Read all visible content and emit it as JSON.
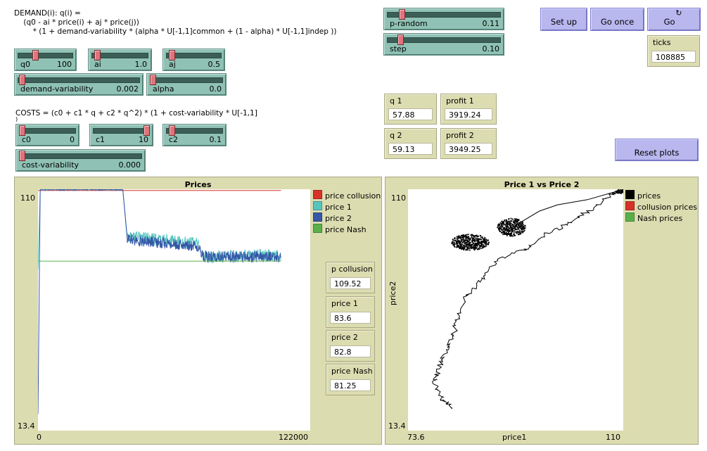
{
  "notes": {
    "demand_line1": "DEMAND(i): q(i) =",
    "demand_line2": "    (q0 - ai * price(i) + aj * price(j))",
    "demand_line3": "        * (1 + demand-variability * (alpha * U[-1,1]common + (1 - alpha) * U[-1,1]indep ))",
    "costs_line1": "COSTS = (c0 + c1 * q + c2 * q^2) * (1 + cost-variability * U[-1,1]",
    "costs_line2": ")"
  },
  "sliders": {
    "q0": {
      "label": "q0",
      "value": "100",
      "fraction": 0.3
    },
    "ai": {
      "label": "ai",
      "value": "1.0",
      "fraction": 0.05
    },
    "aj": {
      "label": "aj",
      "value": "0.5",
      "fraction": 0.05
    },
    "demand_variability": {
      "label": "demand-variability",
      "value": "0.002",
      "fraction": 0.01
    },
    "alpha": {
      "label": "alpha",
      "value": "0.0",
      "fraction": 0.0
    },
    "c0": {
      "label": "c0",
      "value": "0",
      "fraction": 0.0
    },
    "c1": {
      "label": "c1",
      "value": "10",
      "fraction": 1.0
    },
    "c2": {
      "label": "c2",
      "value": "0.1",
      "fraction": 0.05
    },
    "cost_variability": {
      "label": "cost-variability",
      "value": "0.000",
      "fraction": 0.0
    },
    "p_random": {
      "label": "p-random",
      "value": "0.11",
      "fraction": 0.11
    },
    "step": {
      "label": "step",
      "value": "0.10",
      "fraction": 0.1
    }
  },
  "buttons": {
    "setup": "Set up",
    "go_once": "Go once",
    "go": "Go",
    "reset_plots": "Reset plots"
  },
  "monitors": {
    "ticks": {
      "label": "ticks",
      "value": "108885"
    },
    "q1": {
      "label": "q 1",
      "value": "57.88"
    },
    "profit1": {
      "label": "profit 1",
      "value": "3919.24"
    },
    "q2": {
      "label": "q 2",
      "value": "59.13"
    },
    "profit2": {
      "label": "profit 2",
      "value": "3949.25"
    },
    "p_collusion": {
      "label": "p collusion",
      "value": "109.52"
    },
    "price1": {
      "label": "price 1",
      "value": "83.6"
    },
    "price2": {
      "label": "price 2",
      "value": "82.8"
    },
    "price_nash": {
      "label": "price Nash",
      "value": "81.25"
    }
  },
  "prices_plot": {
    "title": "Prices",
    "y_max_label": "110",
    "y_min_label": "13.4",
    "x_min_label": "0",
    "x_max_label": "122000",
    "legend": [
      {
        "name": "price collusion",
        "color": "#d73229"
      },
      {
        "name": "price 1",
        "color": "#57c4c0"
      },
      {
        "name": "price 2",
        "color": "#3656a8"
      },
      {
        "name": "price Nash",
        "color": "#59b04b"
      }
    ]
  },
  "scatter_plot": {
    "title": "Price 1 vs Price 2",
    "y_max_label": "110",
    "y_min_label": "13.4",
    "x_min_label": "73.6",
    "x_max_label": "110",
    "xlabel": "price1",
    "ylabel": "price2",
    "legend": [
      {
        "name": "prices",
        "color": "#000000"
      },
      {
        "name": "collusion prices",
        "color": "#d73229"
      },
      {
        "name": "Nash prices",
        "color": "#59b04b"
      }
    ]
  },
  "chart_data": [
    {
      "type": "line",
      "title": "Prices",
      "xlim": [
        0,
        122000
      ],
      "ylim": [
        13.4,
        110
      ],
      "series": [
        {
          "name": "price collusion",
          "x": [
            0,
            108885
          ],
          "y": [
            109.52,
            109.52
          ]
        },
        {
          "name": "price 1",
          "x": [
            0,
            1000,
            38000,
            40000,
            72000,
            74000,
            108885
          ],
          "y": [
            78,
            110,
            110,
            91,
            88,
            83,
            83.6
          ]
        },
        {
          "name": "price 2",
          "x": [
            0,
            1000,
            38000,
            40000,
            72000,
            74000,
            108885
          ],
          "y": [
            20,
            110,
            110,
            90,
            87,
            83,
            82.8
          ]
        },
        {
          "name": "price Nash",
          "x": [
            0,
            108885
          ],
          "y": [
            81.25,
            81.25
          ]
        }
      ]
    },
    {
      "type": "scatter",
      "title": "Price 1 vs Price 2",
      "xlabel": "price1",
      "ylabel": "price2",
      "xlim": [
        73.6,
        110
      ],
      "ylim": [
        13.4,
        110
      ],
      "series": [
        {
          "name": "prices",
          "x": [
            110,
            108,
            104,
            101,
            97,
            93.5,
            89,
            86,
            83.5,
            82,
            81,
            79.5,
            78.7,
            78,
            79.5,
            81.2
          ],
          "y": [
            110,
            108,
            101,
            96.5,
            92,
            86,
            82,
            74,
            67,
            58,
            50,
            43,
            37,
            33,
            26,
            22
          ]
        }
      ]
    }
  ]
}
